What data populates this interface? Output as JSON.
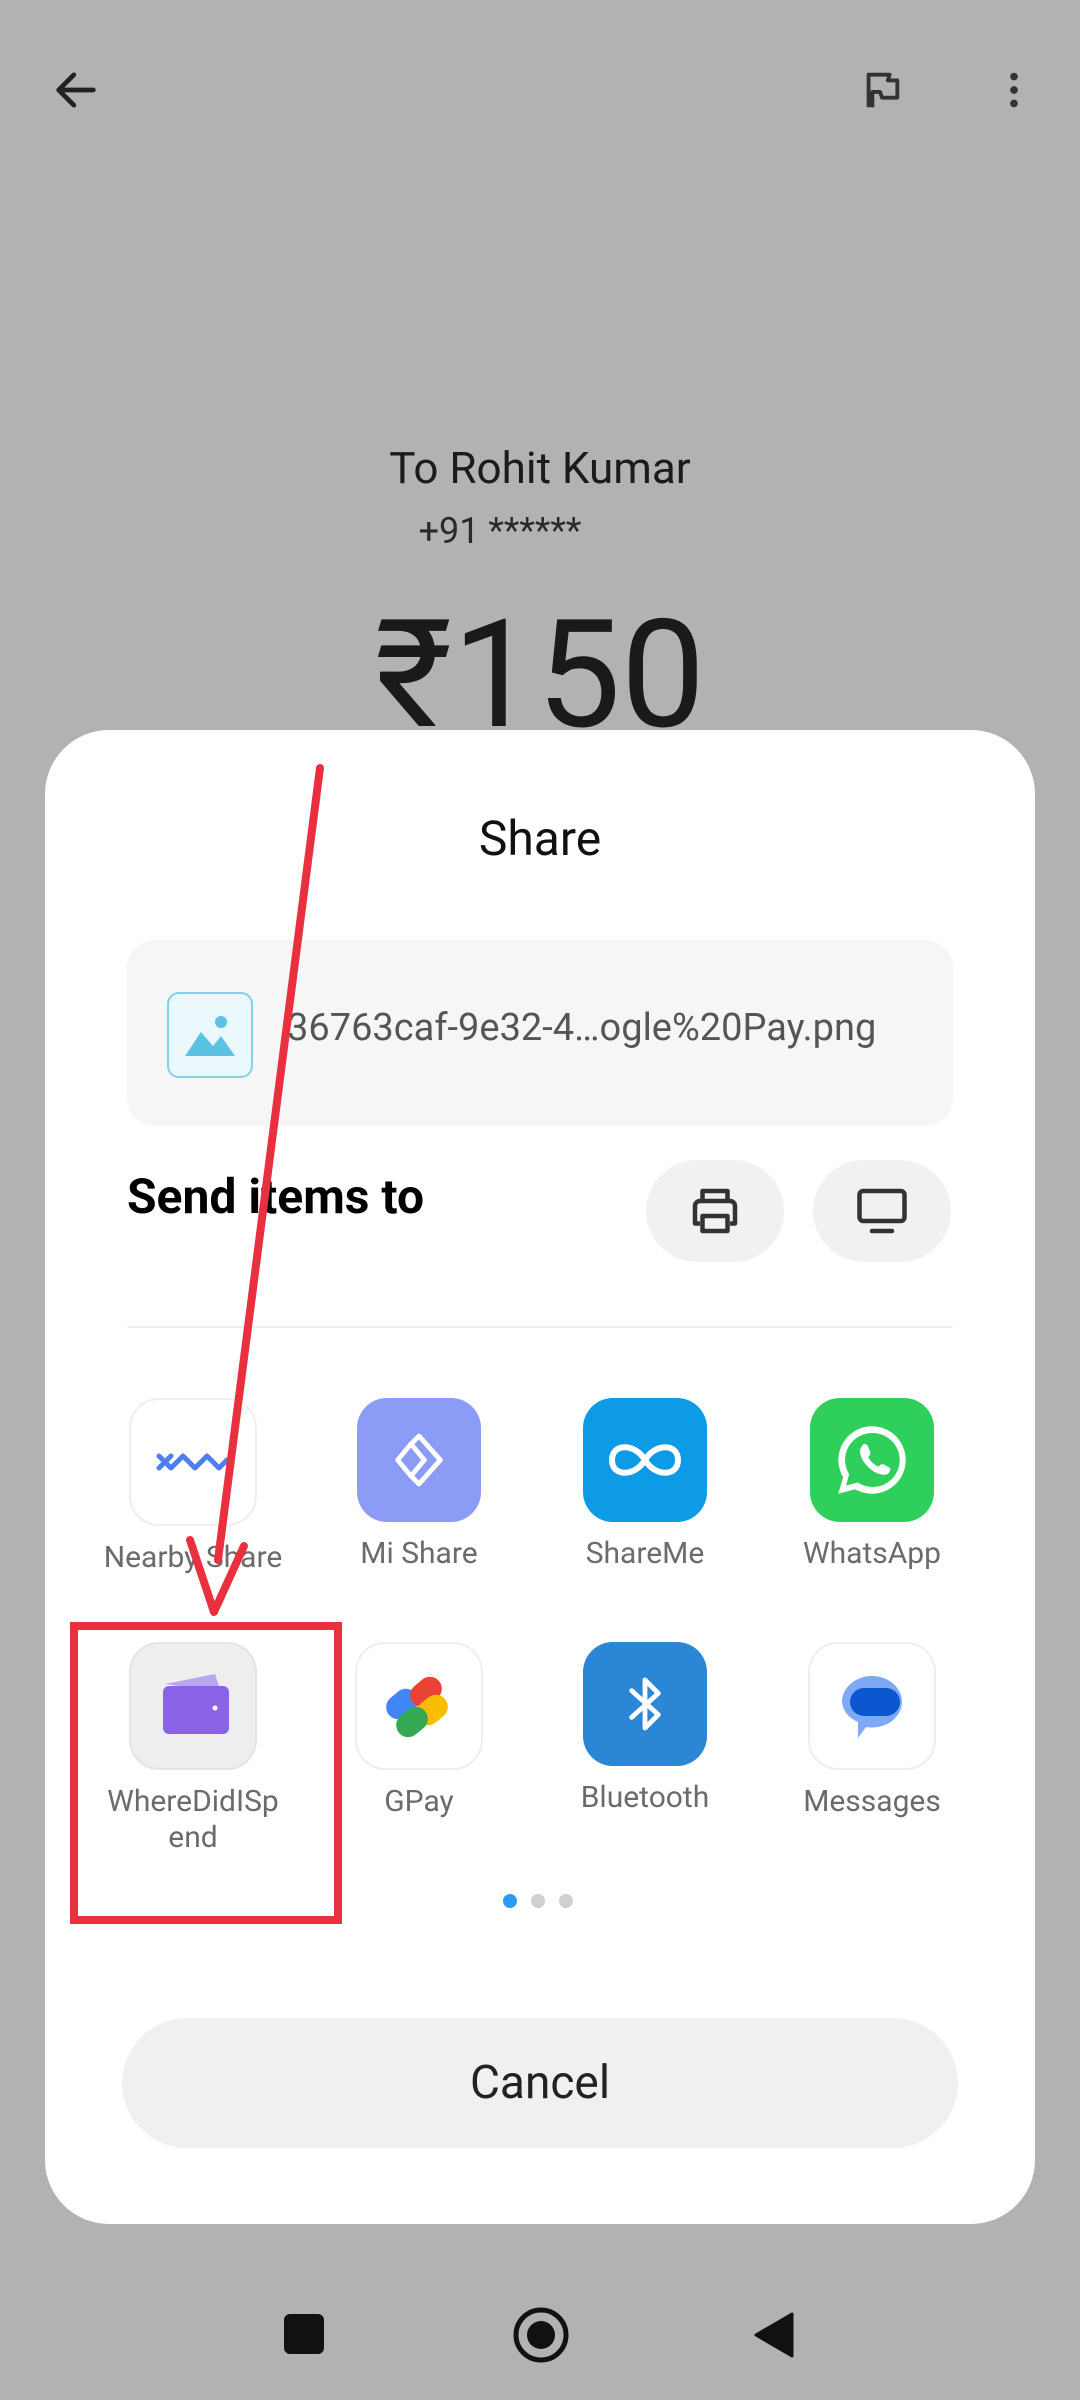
{
  "topbar": {
    "back_icon": "arrow-left-icon",
    "flag_icon": "flag-icon",
    "menu_icon": "more-vertical-icon"
  },
  "payment": {
    "to_name": "To Rohit Kumar",
    "phone": "+91 ******",
    "amount": "₹150"
  },
  "share": {
    "title": "Share",
    "file_name": "36763caf-9e32-4…ogle%20Pay.png",
    "send_items_label": "Send items to",
    "print_icon": "printer-icon",
    "cast_icon": "monitor-icon",
    "apps": [
      {
        "label": "Nearby Share",
        "icon": "nearby-share-icon"
      },
      {
        "label": "Mi Share",
        "icon": "mi-share-icon"
      },
      {
        "label": "ShareMe",
        "icon": "shareme-icon"
      },
      {
        "label": "WhatsApp",
        "icon": "whatsapp-icon"
      },
      {
        "label": "WhereDidISpend",
        "icon": "wallet-icon"
      },
      {
        "label": "GPay",
        "icon": "gpay-icon"
      },
      {
        "label": "Bluetooth",
        "icon": "bluetooth-icon"
      },
      {
        "label": "Messages",
        "icon": "messages-icon"
      }
    ],
    "pages": {
      "current": 1,
      "total": 3
    },
    "cancel_label": "Cancel"
  },
  "navbar": {
    "recents_icon": "square-icon",
    "home_icon": "circle-home-icon",
    "back_icon": "triangle-back-icon"
  },
  "colors": {
    "highlight": "#e8303f",
    "page_dot_active": "#2c9cf0"
  }
}
